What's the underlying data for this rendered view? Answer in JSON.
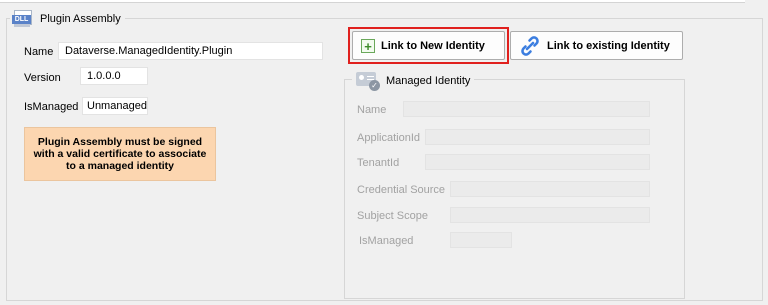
{
  "plugin_assembly": {
    "title": "Plugin Assembly",
    "name_label": "Name",
    "name_value": "Dataverse.ManagedIdentity.Plugin",
    "version_label": "Version",
    "version_value": "1.0.0.0",
    "ismanaged_label": "IsManaged",
    "ismanaged_value": "Unmanaged",
    "warning": "Plugin Assembly must be signed with a valid certificate to associate to a managed identity",
    "icon_text": "DLL"
  },
  "buttons": {
    "link_new": "Link to New Identity",
    "link_existing": "Link to existing Identity"
  },
  "managed_identity": {
    "title": "Managed Identity",
    "name_label": "Name",
    "application_id_label": "ApplicationId",
    "tenant_id_label": "TenantId",
    "credential_source_label": "Credential Source",
    "subject_scope_label": "Subject Scope",
    "ismanaged_label": "IsManaged",
    "name_value": "",
    "application_id_value": "",
    "tenant_id_value": "",
    "credential_source_value": "",
    "subject_scope_value": "",
    "ismanaged_value": ""
  },
  "colors": {
    "highlight": "#e0201e",
    "warning_bg": "#fcd6b0"
  }
}
